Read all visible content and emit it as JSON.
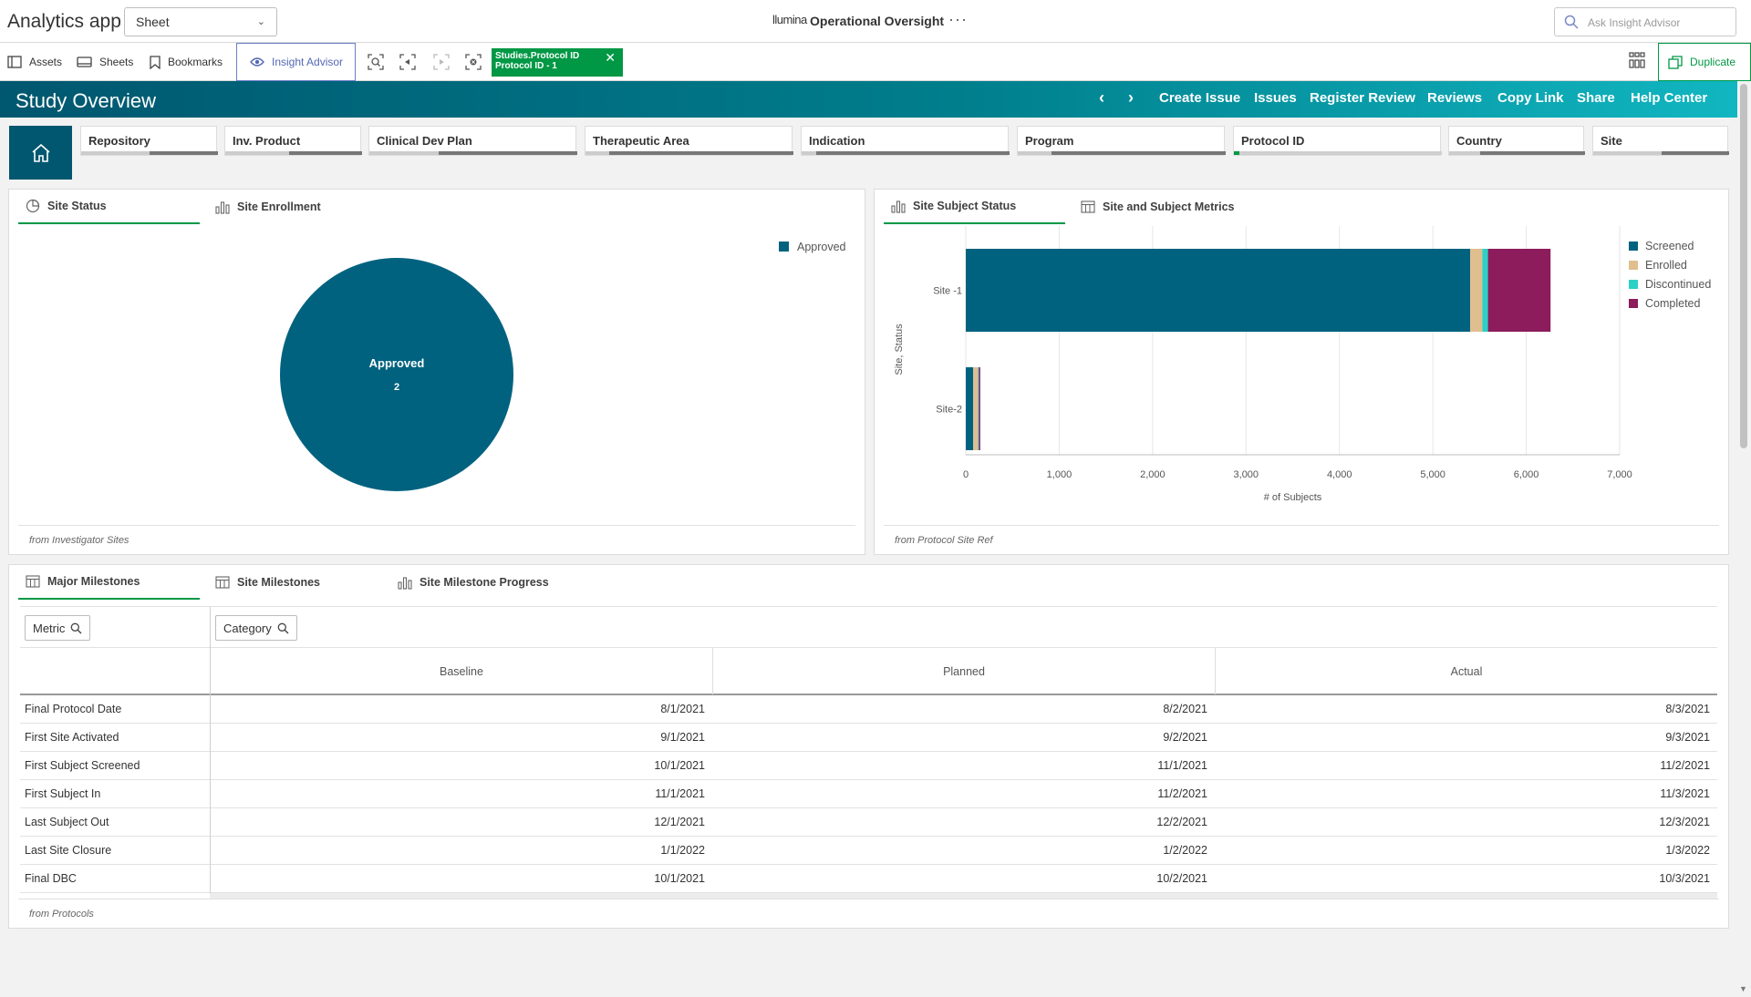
{
  "topbar": {
    "app_title": "Analytics app",
    "sheet_select": "Sheet",
    "brand": "llumina",
    "app_name": "Operational Oversight",
    "more": "···",
    "ask_placeholder": "Ask Insight Advisor"
  },
  "toolbar": {
    "assets": "Assets",
    "sheets": "Sheets",
    "bookmarks": "Bookmarks",
    "insight_advisor": "Insight Advisor",
    "selection_field": "Studies.Protocol ID",
    "selection_value": "Protocol ID - 1",
    "duplicate": "Duplicate"
  },
  "header": {
    "title": "Study Overview",
    "links": [
      "Create Issue",
      "Issues",
      "Register Review",
      "Reviews",
      "Copy Link",
      "Share",
      "Help Center"
    ]
  },
  "filters": [
    "Repository",
    "Inv. Product",
    "Clinical Dev Plan",
    "Therapeutic Area",
    "Indication",
    "Program",
    "Protocol ID",
    "Country",
    "Site"
  ],
  "site_panel": {
    "tabs": [
      "Site Status",
      "Site Enrollment"
    ],
    "footnote": "from Investigator Sites"
  },
  "subject_panel": {
    "tabs": [
      "Site Subject Status",
      "Site and Subject Metrics"
    ],
    "footnote": "from Protocol Site Ref"
  },
  "milestones_panel": {
    "tabs": [
      "Major Milestones",
      "Site Milestones",
      "Site Milestone Progress"
    ],
    "metric_btn": "Metric",
    "category_btn": "Category",
    "columns": [
      "Baseline",
      "Planned",
      "Actual"
    ],
    "rows": [
      {
        "metric": "Final Protocol Date",
        "values": [
          "8/1/2021",
          "8/2/2021",
          "8/3/2021"
        ]
      },
      {
        "metric": "First Site Activated",
        "values": [
          "9/1/2021",
          "9/2/2021",
          "9/3/2021"
        ]
      },
      {
        "metric": "First Subject Screened",
        "values": [
          "10/1/2021",
          "11/1/2021",
          "11/2/2021"
        ]
      },
      {
        "metric": "First Subject In",
        "values": [
          "11/1/2021",
          "11/2/2021",
          "11/3/2021"
        ]
      },
      {
        "metric": "Last Subject Out",
        "values": [
          "12/1/2021",
          "12/2/2021",
          "12/3/2021"
        ]
      },
      {
        "metric": "Last Site Closure",
        "values": [
          "1/1/2022",
          "1/2/2022",
          "1/3/2022"
        ]
      },
      {
        "metric": "Final DBC",
        "values": [
          "10/1/2021",
          "10/2/2021",
          "10/3/2021"
        ]
      }
    ],
    "footnote": "from Protocols"
  },
  "colors": {
    "teal_dark": "#00627f",
    "green": "#009845",
    "enrolled": "#e1be8e",
    "discontinued": "#2ad1c6",
    "completed": "#8c1c5b"
  },
  "chart_data": [
    {
      "type": "pie",
      "labels": [
        "Approved"
      ],
      "values": [
        2
      ],
      "legend": [
        "Approved"
      ],
      "legend_position": "top-right",
      "colors": [
        "#00627f"
      ]
    },
    {
      "type": "bar",
      "orientation": "horizontal",
      "stacked": true,
      "categories": [
        "Site -1",
        "Site-2"
      ],
      "series": [
        {
          "name": "Screened",
          "values": [
            5400,
            80
          ],
          "color": "#00627f"
        },
        {
          "name": "Enrolled",
          "values": [
            130,
            50
          ],
          "color": "#e1be8e"
        },
        {
          "name": "Discontinued",
          "values": [
            60,
            10
          ],
          "color": "#2ad1c6"
        },
        {
          "name": "Completed",
          "values": [
            670,
            15
          ],
          "color": "#8c1c5b"
        }
      ],
      "xlabel": "# of Subjects",
      "ylabel": "Site, Status",
      "xlim": [
        0,
        7000
      ],
      "xticks": [
        "0",
        "1,000",
        "2,000",
        "3,000",
        "4,000",
        "5,000",
        "6,000",
        "7,000"
      ],
      "legend_position": "right",
      "grid": true
    }
  ]
}
